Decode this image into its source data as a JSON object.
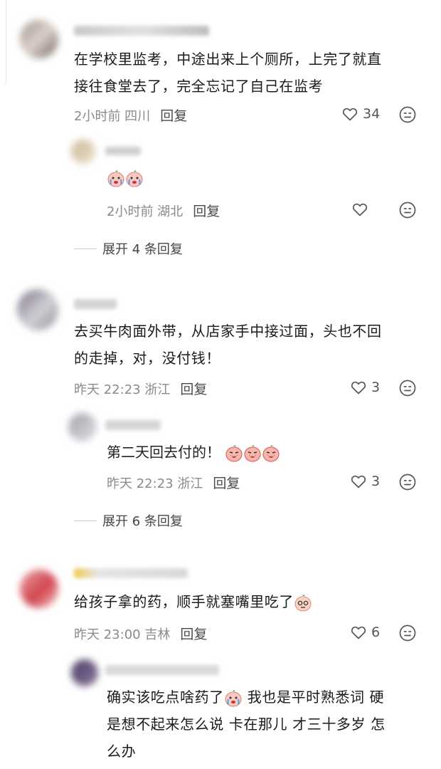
{
  "comments": [
    {
      "text_line1": "在学校里监考，中途出来上个厕所，上完了就直",
      "text_line2": "接往食堂去了，完全忘记了自己在监考",
      "time_location": "2小时前 四川",
      "reply_label": "回复",
      "likes": "34",
      "reply": {
        "time_location": "2小时前 湖北",
        "reply_label": "回复",
        "likes": "",
        "emojis": [
          "crying-emoji",
          "crying-emoji"
        ]
      },
      "expand_label": "展开 4 条回复"
    },
    {
      "text_line1": "去买牛肉面外带，从店家手中接过面，头也不回",
      "text_line2": "的走掉，对，没付钱！",
      "time_location": "昨天 22:23 浙江",
      "reply_label": "回复",
      "likes": "3",
      "reply": {
        "text": "第二天回去付的！",
        "time_location": "昨天 22:23 浙江",
        "reply_label": "回复",
        "likes": "3",
        "emojis": [
          "bawling-emoji",
          "bawling-emoji",
          "bawling-emoji"
        ]
      },
      "expand_label": "展开 6 条回复"
    },
    {
      "text_line1": "给孩子拿的药，顺手就塞嘴里吃了",
      "time_location": "昨天 23:00 吉林",
      "reply_label": "回复",
      "likes": "6",
      "emojis": [
        "speechless-emoji"
      ],
      "reply": {
        "text_part1": "确实该吃点啥药了",
        "text_part2": " 我也是平时熟悉词 硬",
        "text_line2": "是想不起来怎么说  卡在那儿 才三十多岁 怎",
        "text_line3": "么办",
        "emojis": [
          "crying-emoji"
        ]
      }
    }
  ],
  "colors": {
    "text": "#1a1a1a",
    "meta": "#8a8a8a",
    "icon": "#555555"
  }
}
